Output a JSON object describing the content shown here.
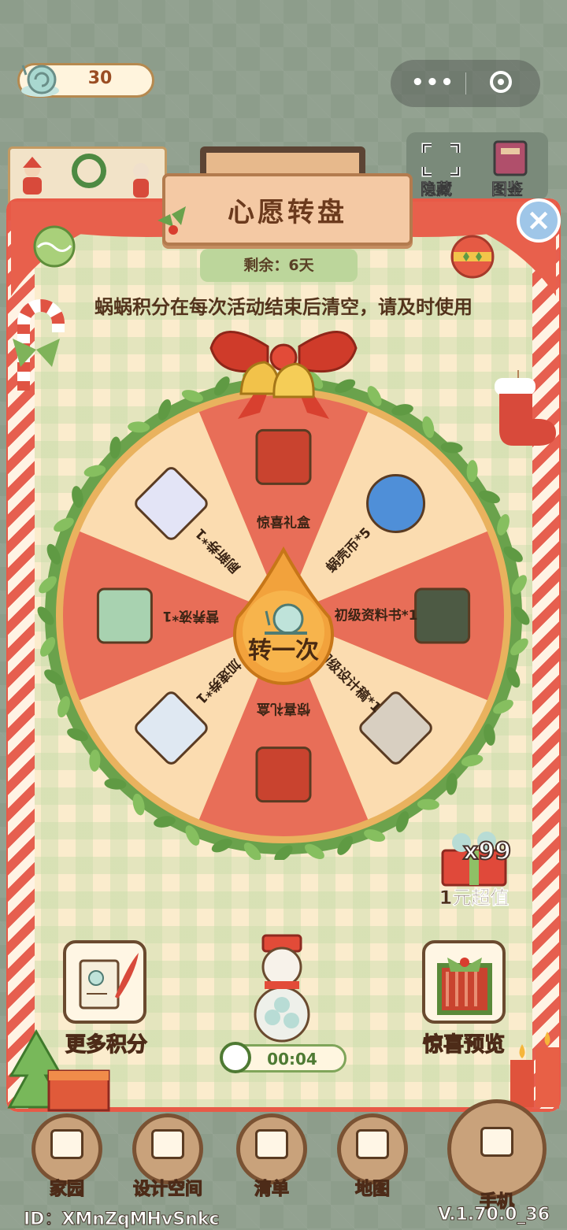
{
  "header": {
    "points_value": "30",
    "capsule_dots": "•••"
  },
  "right_icons": {
    "hide_label": "隐藏",
    "catalog_label": "图鉴"
  },
  "title": "心愿转盘",
  "remaining": "剩余：6天",
  "notice": "蜗蜗积分在每次活动结束后清空，请及时使用",
  "wheel": {
    "spin_label": "转一次",
    "segments": [
      {
        "label": "惊喜礼盒",
        "icon": "gift-box-icon"
      },
      {
        "label": "蜗壳币*5",
        "icon": "snail-coin-icon"
      },
      {
        "label": "初级资料书*1",
        "icon": "book-icon"
      },
      {
        "label": "初级设计稿*1",
        "icon": "blueprint-scroll-icon"
      },
      {
        "label": "惊喜礼盒",
        "icon": "gift-box-icon"
      },
      {
        "label": "加速券*1",
        "icon": "speed-ticket-icon"
      },
      {
        "label": "营养液*1",
        "icon": "nutrient-bottle-icon"
      },
      {
        "label": "刷新券*1",
        "icon": "refresh-ticket-icon"
      }
    ]
  },
  "deal": {
    "multiplier": "x99",
    "label": "1元超值"
  },
  "more_points_label": "更多积分",
  "surprise_preview_label": "惊喜预览",
  "timer": "00:04",
  "nav": [
    {
      "label": "家园",
      "icon": "home-icon"
    },
    {
      "label": "设计空间",
      "icon": "design-ruler-icon"
    },
    {
      "label": "清单",
      "icon": "list-icon"
    },
    {
      "label": "地图",
      "icon": "map-pin-icon"
    },
    {
      "label": "手机",
      "icon": "phone-icon"
    }
  ],
  "footer": {
    "id": "ID：XMnZqMHvSnkc",
    "version": "V.1.70.0_36"
  },
  "colors": {
    "wheel_red": "#e86e58",
    "wheel_cream": "#fbdcb0",
    "accent_green": "#5e9a45",
    "brown_text": "#53331c"
  }
}
